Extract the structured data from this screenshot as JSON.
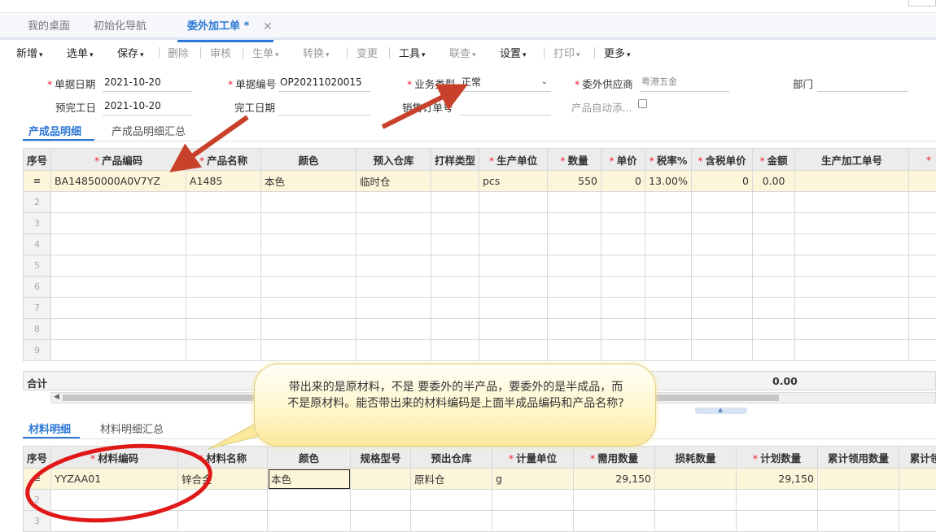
{
  "tabs": [
    {
      "label": "我的桌面"
    },
    {
      "label": "初始化导航"
    },
    {
      "label": "委外加工单 *"
    }
  ],
  "tab_close": "✕",
  "toolbar": [
    {
      "label": "新增",
      "caret": "▾",
      "enabled": true
    },
    {
      "label": "选单",
      "caret": "▾",
      "enabled": true
    },
    {
      "label": "保存",
      "caret": "▾",
      "enabled": true
    },
    {
      "label": "删除",
      "caret": "",
      "enabled": false
    },
    {
      "label": "审核",
      "caret": "",
      "enabled": false
    },
    {
      "label": "生单",
      "caret": "▾",
      "enabled": false
    },
    {
      "label": "转换",
      "caret": "▾",
      "enabled": false
    },
    {
      "label": "变更",
      "caret": "",
      "enabled": false
    },
    {
      "label": "工具",
      "caret": "▾",
      "enabled": true
    },
    {
      "label": "联查",
      "caret": "▾",
      "enabled": false
    },
    {
      "label": "设置",
      "caret": "▾",
      "enabled": true
    },
    {
      "label": "打印",
      "caret": "▾",
      "enabled": false
    },
    {
      "label": "更多",
      "caret": "▾",
      "enabled": true
    }
  ],
  "form": {
    "req_mark": "*",
    "doc_date_label": "单据日期",
    "doc_date": "2021-10-20",
    "doc_no_label": "单据编号",
    "doc_no": "OP20211020015",
    "biz_type_label": "业务类型",
    "biz_type": "正常",
    "supplier_label": "委外供应商",
    "supplier": "粤港五金",
    "dept_label": "部门",
    "plan_done_label": "预完工日",
    "plan_done": "2021-10-20",
    "done_date_label": "完工日期",
    "sales_order_label": "销售订单号",
    "auto_product_label": "产品自动添..."
  },
  "product_section": {
    "tab_detail": "产成品明细",
    "tab_summary": "产成品明细汇总",
    "columns": [
      {
        "label": "序号",
        "req": false
      },
      {
        "label": "产品编码",
        "req": true
      },
      {
        "label": "产品名称",
        "req": true
      },
      {
        "label": "颜色",
        "req": false
      },
      {
        "label": "预入仓库",
        "req": false
      },
      {
        "label": "打样类型",
        "req": false
      },
      {
        "label": "生产单位",
        "req": true
      },
      {
        "label": "数量",
        "req": true
      },
      {
        "label": "单价",
        "req": true
      },
      {
        "label": "税率%",
        "req": true
      },
      {
        "label": "含税单价",
        "req": true
      },
      {
        "label": "金额",
        "req": true
      },
      {
        "label": "生产加工单号",
        "req": false
      },
      {
        "label": "",
        "req": true
      }
    ],
    "rows": [
      {
        "code": "BA14850000A0V7YZ",
        "name": "A1485",
        "color": "本色",
        "warehouse": "临时仓",
        "sample": "",
        "unit": "pcs",
        "qty": "550",
        "price": "0",
        "tax": "13.00%",
        "tax_price": "0",
        "amount": "0.00",
        "order_no": ""
      }
    ],
    "row_numbers": [
      "2",
      "3",
      "4",
      "5",
      "6",
      "7",
      "8",
      "9"
    ],
    "total_label": "合计",
    "total_amount": "0.00"
  },
  "material_section": {
    "tab_detail": "材料明细",
    "tab_summary": "材料明细汇总",
    "columns": [
      {
        "label": "序号",
        "req": false
      },
      {
        "label": "材料编码",
        "req": true
      },
      {
        "label": "材料名称",
        "req": true
      },
      {
        "label": "颜色",
        "req": false
      },
      {
        "label": "规格型号",
        "req": false
      },
      {
        "label": "预出仓库",
        "req": false
      },
      {
        "label": "计量单位",
        "req": true
      },
      {
        "label": "需用数量",
        "req": true
      },
      {
        "label": "损耗数量",
        "req": false
      },
      {
        "label": "计划数量",
        "req": true
      },
      {
        "label": "累计领用数量",
        "req": false
      },
      {
        "label": "累计领",
        "req": false
      }
    ],
    "rows": [
      {
        "code": "YYZAA01",
        "name": "锌合金",
        "color": "本色",
        "spec": "",
        "warehouse": "原料仓",
        "unit": "g",
        "need": "29,150",
        "loss": "",
        "plan": "29,150",
        "used": "",
        "used2": ""
      }
    ],
    "row_numbers": [
      "2",
      "3"
    ]
  },
  "annotation": {
    "text": "带出来的是原材料，不是 要委外的半产品，要委外的是半成品，而不是原材料。能否带出来的材料编码是上面半成品编码和产品名称?"
  },
  "colors": {
    "accent": "#2d78d6",
    "required": "#e23",
    "selected_row": "#fdf5d9",
    "annotation_arrow": "#c8412a",
    "annotation_circle": "#e01818"
  }
}
